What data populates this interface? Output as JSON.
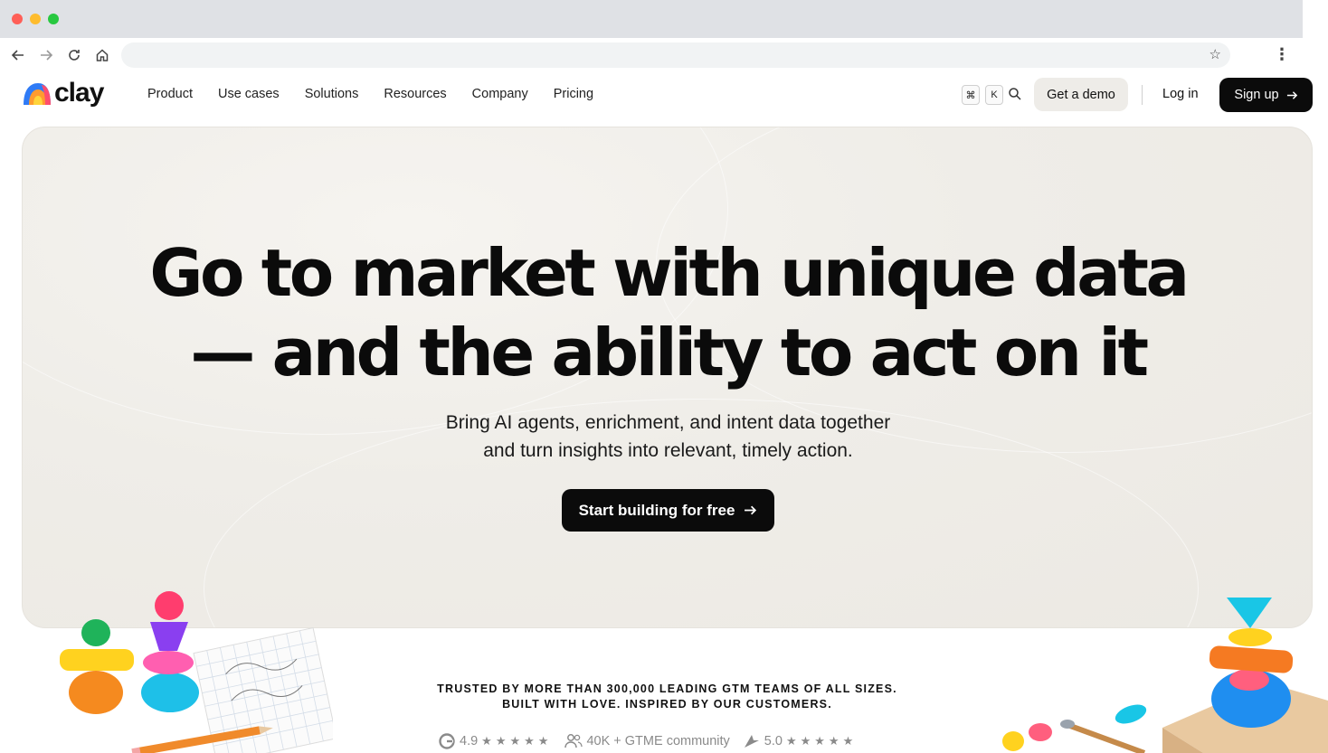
{
  "browser": {
    "back_icon": "arrow-left-icon",
    "forward_icon": "arrow-right-icon",
    "reload_icon": "reload-icon",
    "home_icon": "home-icon",
    "url": "",
    "bookmark_icon": "star-icon",
    "menu_icon": "kebab-icon"
  },
  "nav": {
    "logo_text": "clay",
    "links": [
      "Product",
      "Use cases",
      "Solutions",
      "Resources",
      "Company",
      "Pricing"
    ],
    "shortcut_keys": [
      "⌘",
      "K"
    ],
    "demo_label": "Get a demo",
    "login_label": "Log in",
    "signup_label": "Sign up"
  },
  "hero": {
    "headline_line1": "Go to market with unique data",
    "headline_line2": "— and the ability to act on it",
    "sub_line1": "Bring AI agents, enrichment, and intent data together",
    "sub_line2": "and turn insights into relevant, timely action.",
    "cta_label": "Start building for free"
  },
  "trust": {
    "line1": "TRUSTED BY MORE THAN 300,000 LEADING GTM TEAMS OF ALL SIZES.",
    "line2": "BUILT WITH LOVE. INSPIRED BY OUR CUSTOMERS.",
    "g2_rating": "4.9",
    "community": "40K + GTME community",
    "capterra_rating": "5.0",
    "stars": "★★★★★"
  },
  "colors": {
    "primary_button": "#0b0b0b",
    "demo_button": "#eeece8",
    "hero_background": "#efede8"
  }
}
